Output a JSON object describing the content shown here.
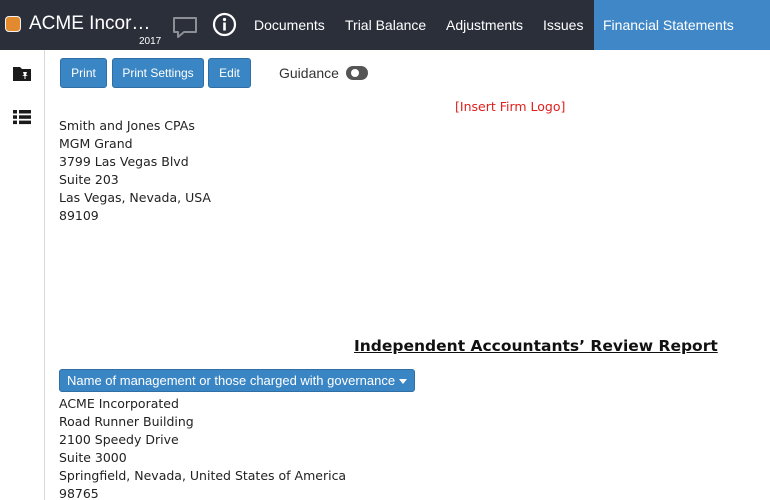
{
  "header": {
    "app_title": "ACME Incor…",
    "year": "2017",
    "chat_icon": "speech-bubble-icon",
    "info_icon": "info-circle-icon",
    "tabs": [
      {
        "label": "Documents"
      },
      {
        "label": "Trial Balance"
      },
      {
        "label": "Adjustments"
      },
      {
        "label": "Issues"
      },
      {
        "label": "Financial Statements",
        "active": true
      }
    ],
    "active_tab_color": "#3f87c7",
    "bar_color": "#2b2f3a",
    "app_dot_color": "#e38a2e"
  },
  "left_rail": {
    "icons": [
      "folder-pin-icon",
      "list-icon"
    ]
  },
  "toolbar": {
    "print_label": "Print",
    "print_settings_label": "Print Settings",
    "edit_label": "Edit",
    "guidance_label": "Guidance",
    "guidance_on": false,
    "button_color": "#3a85c4"
  },
  "document": {
    "firm_logo_placeholder": "[Insert Firm Logo]",
    "firm_address": [
      "Smith and Jones CPAs",
      "MGM Grand",
      "3799 Las Vegas Blvd",
      "Suite 203",
      "Las Vegas, Nevada, USA",
      "89109"
    ],
    "report_title": "Independent Accountants’ Review Report",
    "addressee_dropdown": "Name of management or those charged with governance",
    "client_address": [
      "ACME Incorporated",
      "Road Runner Building",
      "2100 Speedy Drive",
      "Suite 3000",
      "Springfield, Nevada, United States of America",
      "98765"
    ]
  }
}
